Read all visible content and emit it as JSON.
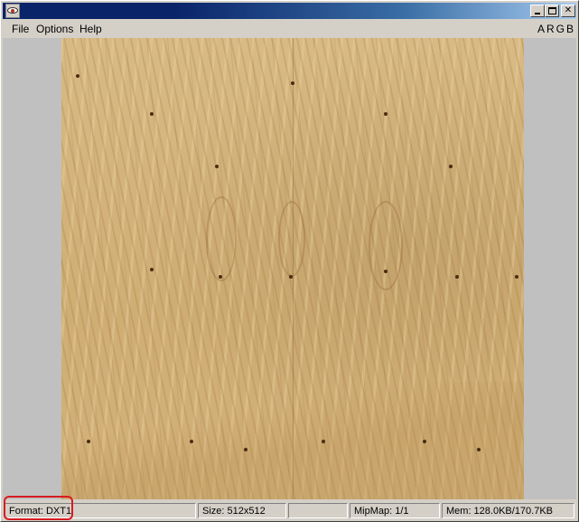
{
  "menubar": {
    "items": [
      "File",
      "Options",
      "Help"
    ],
    "channels": "ARGB"
  },
  "titlebar": {
    "icon": "eye-app-icon",
    "buttons": [
      "minimize",
      "maximize",
      "close"
    ]
  },
  "statusbar": {
    "format": "Format: DXT1",
    "size": "Size: 512x512",
    "mipmap": "MipMap: 1/1",
    "memory": "Mem: 128.0KB/170.7KB"
  },
  "colors": {
    "titlebar": "#0a246a",
    "highlight": "#d81b20",
    "wood": "#d2b27a"
  }
}
